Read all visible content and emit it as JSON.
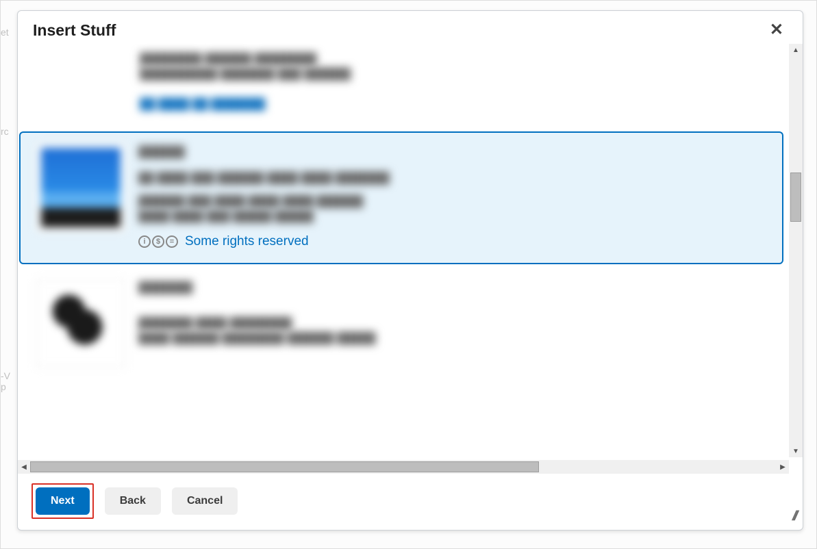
{
  "dialog": {
    "title": "Insert Stuff"
  },
  "results": {
    "top_partial": {
      "line1": "████████ ██████ ████████",
      "line2": "██████████ ███████ ███ ██████",
      "link": "██ ████ ██ ███████"
    },
    "selected": {
      "title": "██████",
      "desc": "██ ████ ███ ██████ ████ ████ ███████",
      "meta1": "██████ ███ ████ ████ ████ ██████",
      "meta2": "████ ████ ███ █████ █████",
      "rights": "Some rights reserved"
    },
    "bottom_partial": {
      "title": "███████",
      "meta1": "███████ ████ ████████",
      "meta2": "████ ██████ ████████ ██████ █████"
    }
  },
  "footer": {
    "next": "Next",
    "back": "Back",
    "cancel": "Cancel"
  }
}
